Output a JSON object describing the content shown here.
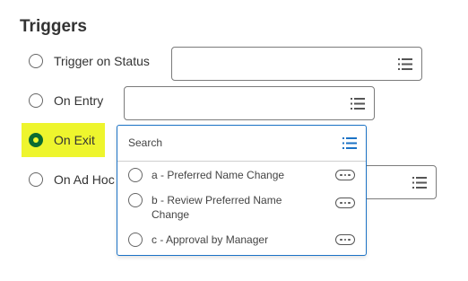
{
  "section": {
    "title": "Triggers"
  },
  "options": [
    {
      "label": "Trigger on Status",
      "selected": false
    },
    {
      "label": "On Entry",
      "selected": false
    },
    {
      "label": "On Exit",
      "selected": true
    },
    {
      "label": "On Ad Hoc",
      "selected": false
    }
  ],
  "dropdown": {
    "search_label": "Search",
    "items": [
      {
        "label": "a - Preferred Name Change"
      },
      {
        "label": "b - Review Preferred Name Change"
      },
      {
        "label": "c - Approval by Manager"
      }
    ]
  },
  "icons": {
    "field_picker": "list-icon",
    "item_actions": "more-horizontal-icon"
  },
  "colors": {
    "highlight": "#eef52d",
    "selected_radio": "#0b6b32",
    "dropdown_border": "#1c73c6",
    "list_icon_active": "#1c73c6"
  }
}
